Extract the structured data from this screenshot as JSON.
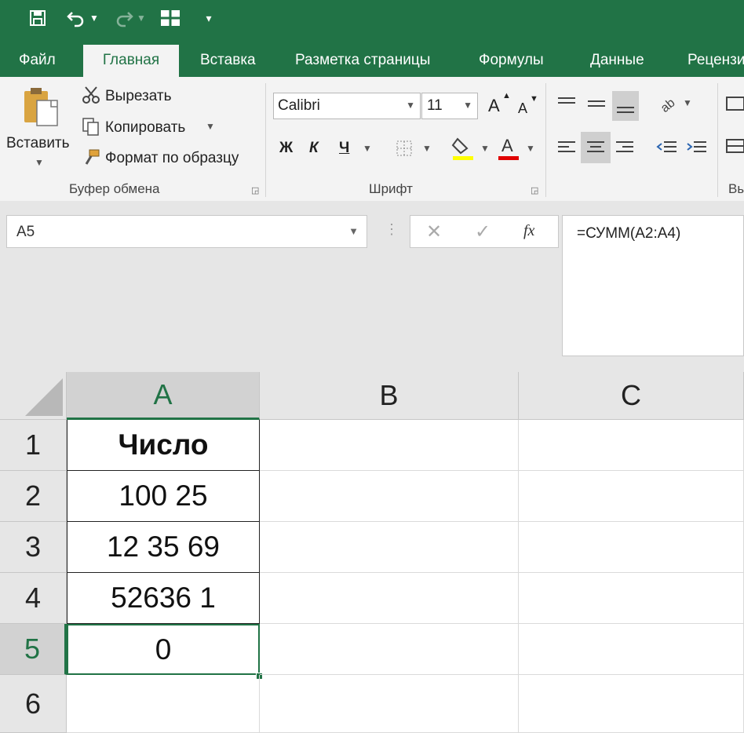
{
  "quick_access": {
    "save_icon": "save-icon",
    "undo_icon": "undo-icon",
    "redo_icon": "redo-icon",
    "form_icon": "form-icon",
    "customize_icon": "customize-icon"
  },
  "tabs": [
    {
      "label": "Файл"
    },
    {
      "label": "Главная"
    },
    {
      "label": "Вставка"
    },
    {
      "label": "Разметка страницы"
    },
    {
      "label": "Формулы"
    },
    {
      "label": "Данные"
    },
    {
      "label": "Рецензи"
    }
  ],
  "active_tab": "Главная",
  "clipboard": {
    "paste_label": "Вставить",
    "cut_label": "Вырезать",
    "copy_label": "Копировать",
    "format_painter_label": "Формат по образцу",
    "group_label": "Буфер обмена"
  },
  "font": {
    "font_name": "Calibri",
    "font_size": "11",
    "bold": "Ж",
    "italic": "К",
    "underline": "Ч",
    "font_color_letter": "A",
    "grow_letter": "A",
    "shrink_letter": "A",
    "group_label": "Шрифт",
    "fill_color": "#ffff00",
    "text_color": "#e00000"
  },
  "alignment": {
    "group_label_partial": "Вы"
  },
  "formula_bar": {
    "name_box": "A5",
    "fx_label": "fx",
    "formula": "=СУММ(A2:A4)"
  },
  "columns": [
    "A",
    "B",
    "C"
  ],
  "selected_column": "A",
  "rows": [
    {
      "number": "1",
      "a": "Число",
      "bold": true
    },
    {
      "number": "2",
      "a": "100 25"
    },
    {
      "number": "3",
      "a": "12 35 69"
    },
    {
      "number": "4",
      "a": "52636 1"
    },
    {
      "number": "5",
      "a": "0"
    },
    {
      "number": "6",
      "a": ""
    }
  ],
  "selected_row": "5",
  "colors": {
    "accent": "#217346",
    "ribbon_bg": "#f3f3f3"
  }
}
